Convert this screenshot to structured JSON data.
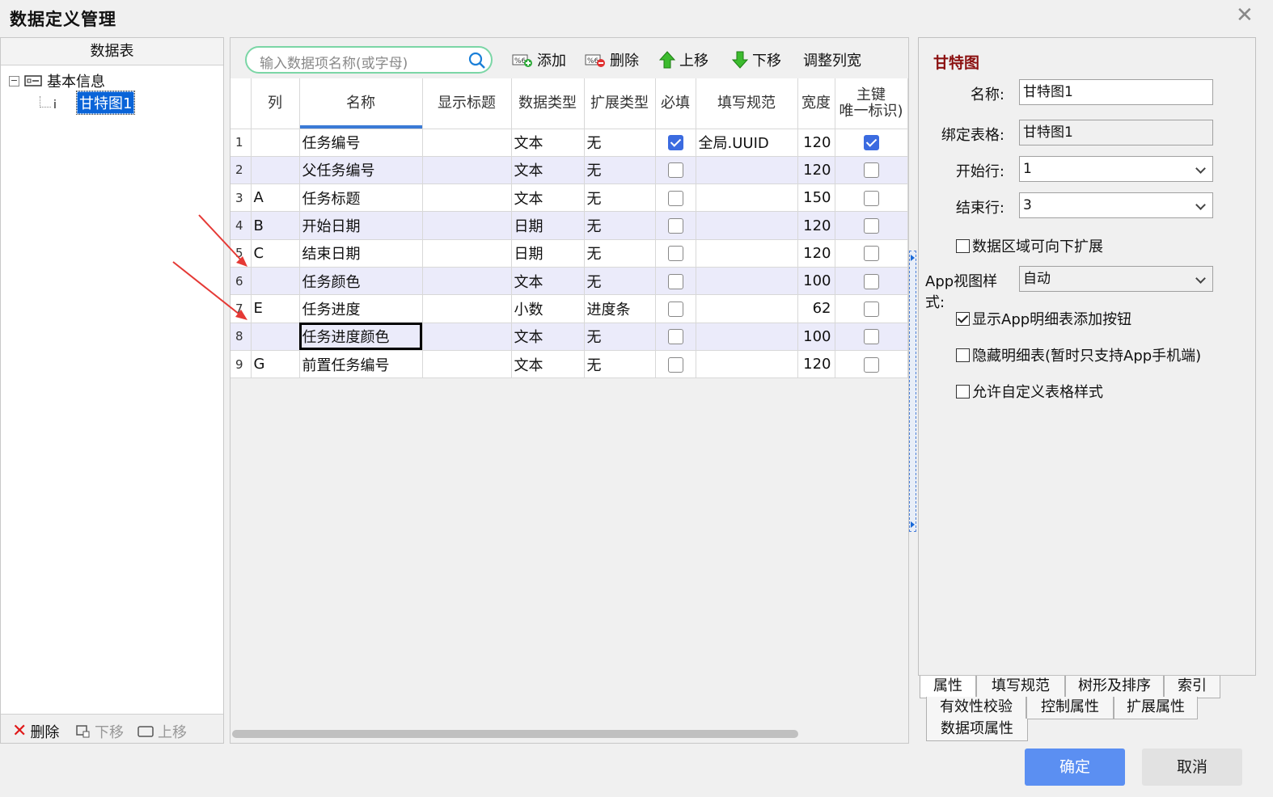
{
  "window": {
    "title": "数据定义管理"
  },
  "left": {
    "header": "数据表",
    "tree": {
      "root": "基本信息",
      "child": "甘特图1"
    },
    "buttons": {
      "delete": "删除",
      "down": "下移",
      "up": "上移"
    }
  },
  "toolbar": {
    "search_placeholder": "输入数据项名称(或字母)",
    "add": "添加",
    "delete": "删除",
    "up": "上移",
    "down": "下移",
    "adjust": "调整列宽"
  },
  "grid": {
    "headers": {
      "col": "列",
      "name": "名称",
      "display": "显示标题",
      "dtype": "数据类型",
      "etype": "扩展类型",
      "required": "必填",
      "rule": "填写规范",
      "width": "宽度",
      "pk1": "主键",
      "pk2": "唯一标识)"
    },
    "rows": [
      {
        "n": "1",
        "col": "",
        "name": "任务编号",
        "display": "",
        "dtype": "文本",
        "etype": "无",
        "required": true,
        "rule": "全局.UUID",
        "width": "120",
        "pk": true
      },
      {
        "n": "2",
        "col": "",
        "name": "父任务编号",
        "display": "",
        "dtype": "文本",
        "etype": "无",
        "required": false,
        "rule": "",
        "width": "120",
        "pk": false
      },
      {
        "n": "3",
        "col": "A",
        "name": "任务标题",
        "display": "",
        "dtype": "文本",
        "etype": "无",
        "required": false,
        "rule": "",
        "width": "150",
        "pk": false
      },
      {
        "n": "4",
        "col": "B",
        "name": "开始日期",
        "display": "",
        "dtype": "日期",
        "etype": "无",
        "required": false,
        "rule": "",
        "width": "120",
        "pk": false
      },
      {
        "n": "5",
        "col": "C",
        "name": "结束日期",
        "display": "",
        "dtype": "日期",
        "etype": "无",
        "required": false,
        "rule": "",
        "width": "120",
        "pk": false
      },
      {
        "n": "6",
        "col": "",
        "name": "任务颜色",
        "display": "",
        "dtype": "文本",
        "etype": "无",
        "required": false,
        "rule": "",
        "width": "100",
        "pk": false
      },
      {
        "n": "7",
        "col": "E",
        "name": "任务进度",
        "display": "",
        "dtype": "小数",
        "etype": "进度条",
        "required": false,
        "rule": "",
        "width": "62",
        "pk": false
      },
      {
        "n": "8",
        "col": "",
        "name": "任务进度颜色",
        "display": "",
        "dtype": "文本",
        "etype": "无",
        "required": false,
        "rule": "",
        "width": "100",
        "pk": false
      },
      {
        "n": "9",
        "col": "G",
        "name": "前置任务编号",
        "display": "",
        "dtype": "文本",
        "etype": "无",
        "required": false,
        "rule": "",
        "width": "120",
        "pk": false
      }
    ]
  },
  "props": {
    "title": "甘特图",
    "name_label": "名称:",
    "name_value": "甘特图1",
    "bind_label": "绑定表格:",
    "bind_value": "甘特图1",
    "start_label": "开始行:",
    "start_value": "1",
    "end_label": "结束行:",
    "end_value": "3",
    "extend_down": {
      "label": "数据区域可向下扩展",
      "checked": false
    },
    "app_style_label": "App视图样式:",
    "app_style_value": "自动",
    "show_add": {
      "label": "显示App明细表添加按钮",
      "checked": true
    },
    "hide_detail": {
      "label": "隐藏明细表(暂时只支持App手机端)",
      "checked": false
    },
    "custom_style": {
      "label": "允许自定义表格样式",
      "checked": false
    },
    "tabs_row1": [
      "属性",
      "填写规范",
      "树形及排序",
      "索引"
    ],
    "tabs_row2": [
      "有效性校验",
      "控制属性",
      "扩展属性"
    ],
    "tabs_row3": [
      "数据项属性"
    ]
  },
  "footer": {
    "ok": "确定",
    "cancel": "取消"
  },
  "colors": {
    "primary": "#5b8ff2",
    "accent_title": "#8b1010",
    "checked": "#3b6be0",
    "annotation_arrow": "#e53935",
    "row_alt": "#ebebfa",
    "search_border": "#7bd6a6"
  }
}
